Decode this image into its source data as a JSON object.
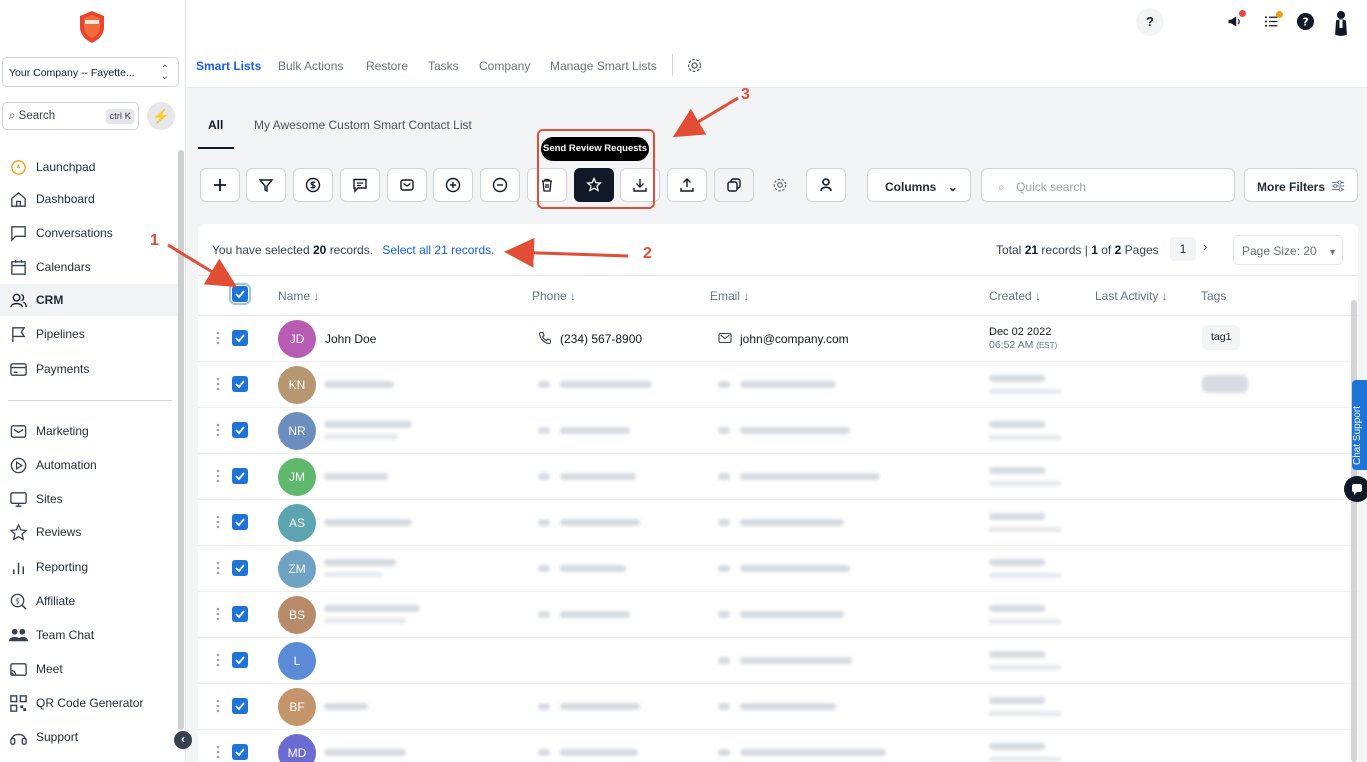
{
  "sidebar": {
    "company": "Your Company -- Fayette...",
    "search_label": "Search",
    "search_shortcut": "ctrl K",
    "items": [
      {
        "label": "Launchpad",
        "icon": "rocket-icon"
      },
      {
        "label": "Dashboard",
        "icon": "home-icon"
      },
      {
        "label": "Conversations",
        "icon": "chat-icon"
      },
      {
        "label": "Calendars",
        "icon": "calendar-icon"
      },
      {
        "label": "CRM",
        "icon": "users-icon"
      },
      {
        "label": "Pipelines",
        "icon": "flag-icon"
      },
      {
        "label": "Payments",
        "icon": "card-icon"
      },
      {
        "label": "Marketing",
        "icon": "mail-icon"
      },
      {
        "label": "Automation",
        "icon": "play-icon"
      },
      {
        "label": "Sites",
        "icon": "monitor-icon"
      },
      {
        "label": "Reviews",
        "icon": "star-icon"
      },
      {
        "label": "Reporting",
        "icon": "bar-chart-icon"
      },
      {
        "label": "Affiliate",
        "icon": "dollar-icon"
      },
      {
        "label": "Team Chat",
        "icon": "team-icon"
      },
      {
        "label": "Meet",
        "icon": "cast-icon"
      },
      {
        "label": "QR Code Generator",
        "icon": "qr-code-icon"
      },
      {
        "label": "Support",
        "icon": "headset-icon"
      }
    ]
  },
  "topbar": {
    "help_label": "?"
  },
  "tabs": [
    {
      "label": "Smart Lists"
    },
    {
      "label": "Bulk Actions"
    },
    {
      "label": "Restore"
    },
    {
      "label": "Tasks"
    },
    {
      "label": "Company"
    },
    {
      "label": "Manage Smart Lists"
    }
  ],
  "subtabs": [
    {
      "label": "All"
    },
    {
      "label": "My Awesome Custom Smart Contact List"
    }
  ],
  "toolbar": {
    "tooltip": "Send Review Requests",
    "columns_label": "Columns",
    "search_placeholder": "Quick search",
    "more_filters_label": "More Filters"
  },
  "selection": {
    "prefix": "You have selected",
    "count": "20",
    "suffix": "records.",
    "select_all": "Select all 21 records."
  },
  "pagination": {
    "prefix": "Total",
    "total": "21",
    "mid": "records |",
    "page": "1",
    "of": "of",
    "pages": "2",
    "pages_word": "Pages",
    "current": "1",
    "next": "›",
    "page_size": "Page Size: 20"
  },
  "table": {
    "columns": [
      "Name",
      "Phone",
      "Email",
      "Created",
      "Last Activity",
      "Tags"
    ],
    "rows": [
      {
        "initials": "JD",
        "color": "#b85bb3",
        "name": "John Doe",
        "phone": "(234) 567-8900",
        "email": "john@company.com",
        "created_date": "Dec 02 2022",
        "created_time": "06:52 AM",
        "tz": "(EST)",
        "tag": "tag1"
      },
      {
        "initials": "KN",
        "color": "#b79672"
      },
      {
        "initials": "NR",
        "color": "#6c8ebf"
      },
      {
        "initials": "JM",
        "color": "#5fb86c"
      },
      {
        "initials": "AS",
        "color": "#5ca5b0"
      },
      {
        "initials": "ZM",
        "color": "#6ea3c4"
      },
      {
        "initials": "BS",
        "color": "#b88c6a"
      },
      {
        "initials": "L",
        "color": "#5b8ad6"
      },
      {
        "initials": "BF",
        "color": "#c4946b"
      },
      {
        "initials": "MD",
        "color": "#6b6bd1"
      }
    ]
  },
  "chat_support": "Chat Support",
  "annotations": [
    "1",
    "2",
    "3"
  ],
  "colors": {
    "accent": "#155eef",
    "checkbox": "#1e74d6",
    "annotation": "#e24d36"
  }
}
